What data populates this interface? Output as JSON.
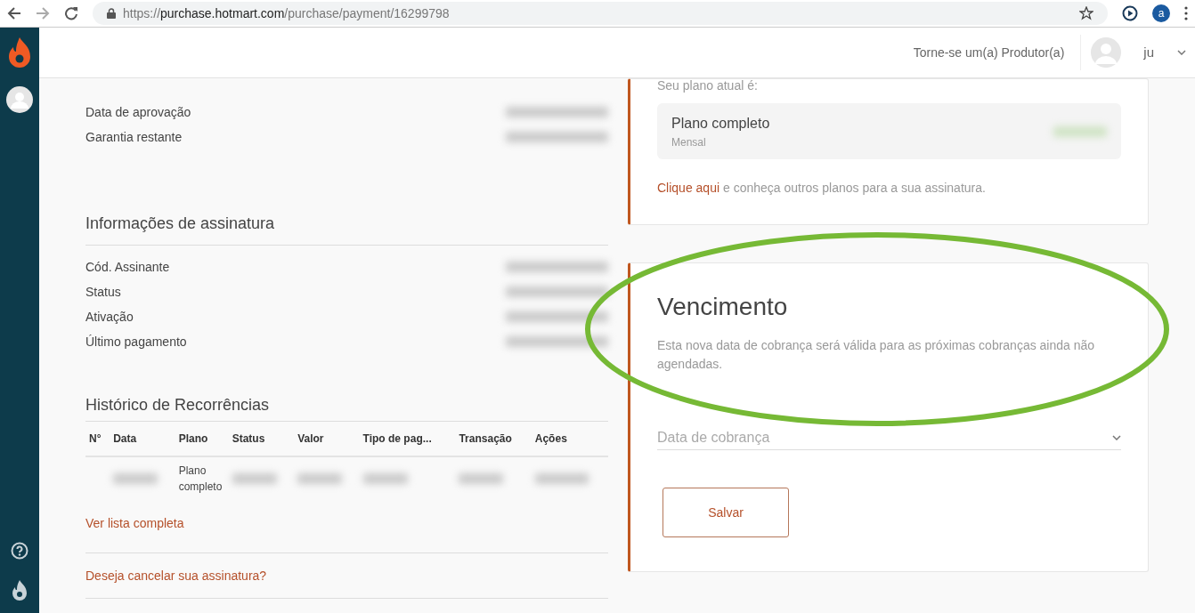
{
  "browser": {
    "url": {
      "scheme": "https://",
      "host": "purchase.hotmart.com",
      "path": "/purchase/payment/16299798"
    },
    "profile_initial": "a"
  },
  "header": {
    "producer_link": "Torne-se um(a) Produtor(a)",
    "user_name": "ju"
  },
  "purchase_details": {
    "rows": [
      {
        "label": "Data de aprovação"
      },
      {
        "label": "Garantia restante"
      }
    ]
  },
  "subscription_info": {
    "title": "Informações de assinatura",
    "rows": [
      {
        "label": "Cód. Assinante"
      },
      {
        "label": "Status"
      },
      {
        "label": "Ativação"
      },
      {
        "label": "Último pagamento"
      }
    ]
  },
  "history": {
    "title": "Histórico de Recorrências",
    "columns": [
      "N°",
      "Data",
      "Plano",
      "Status",
      "Valor",
      "Tipo de pag...",
      "Transação",
      "Ações"
    ],
    "rows": [
      {
        "column_3": "Plano completo"
      }
    ],
    "see_all_link": "Ver lista completa",
    "cancel_link": "Deseja cancelar sua assinatura?"
  },
  "plan_card": {
    "intro": "Seu plano atual é:",
    "plan_name": "Plano completo",
    "plan_period": "Mensal",
    "change_link": "Clique aqui",
    "change_text": " e conheça outros planos para a sua assinatura."
  },
  "due_card": {
    "title": "Vencimento",
    "description": "Esta nova data de cobrança será válida para as próximas cobranças ainda não agendadas.",
    "date_select": {
      "placeholder": "Data de cobrança"
    },
    "save_button": "Salvar"
  },
  "annotation": {
    "kind": "ellipse"
  }
}
